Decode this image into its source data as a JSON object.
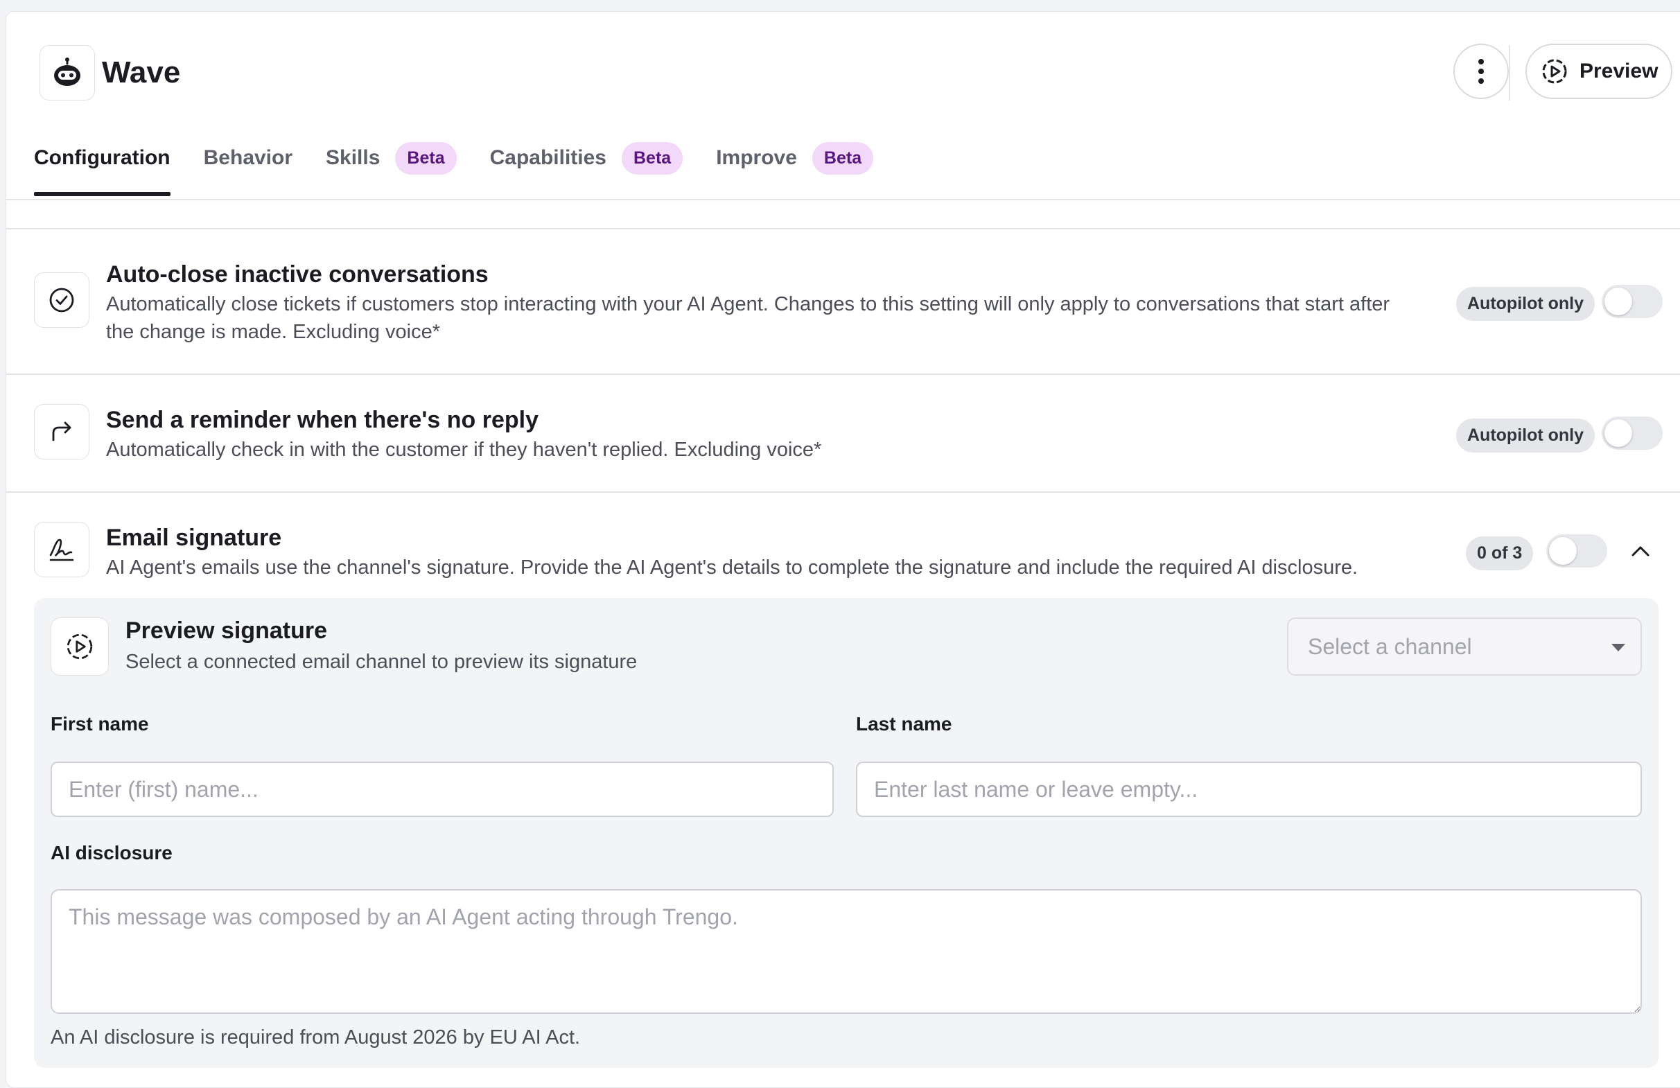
{
  "header": {
    "title": "Wave",
    "logo_icon": "robot-icon",
    "more_icon": "more-vertical-icon",
    "preview_label": "Preview",
    "preview_icon": "play-circle-dashed-icon"
  },
  "tabs": [
    {
      "label": "Configuration",
      "active": true,
      "badge": ""
    },
    {
      "label": "Behavior",
      "active": false,
      "badge": ""
    },
    {
      "label": "Skills",
      "active": false,
      "badge": "Beta"
    },
    {
      "label": "Capabilities",
      "active": false,
      "badge": "Beta"
    },
    {
      "label": "Improve",
      "active": false,
      "badge": "Beta"
    }
  ],
  "settings": {
    "auto_close": {
      "icon": "check-circle-icon",
      "title": "Auto-close inactive conversations",
      "description": "Automatically close tickets if customers stop interacting with your AI Agent. Changes to this setting will only apply to conversations that start after the change is made. Excluding voice*",
      "pill": "Autopilot only",
      "enabled": false
    },
    "reminder": {
      "icon": "forward-arrow-icon",
      "title": "Send a reminder when there's no reply",
      "description": "Automatically check in with the customer if they haven't replied. Excluding voice*",
      "pill": "Autopilot only",
      "enabled": false
    },
    "email_signature": {
      "icon": "signature-icon",
      "title": "Email signature",
      "description": "AI Agent's emails use the channel's signature. Provide the AI Agent's details to complete the signature and include the required AI disclosure.",
      "count": "0 of 3",
      "enabled": false,
      "expanded": true
    }
  },
  "signature": {
    "preview_title": "Preview signature",
    "preview_desc": "Select a connected email channel to preview its signature",
    "channel_placeholder": "Select a channel",
    "first_name_label": "First name",
    "first_name_placeholder": "Enter (first) name...",
    "first_name_value": "",
    "last_name_label": "Last name",
    "last_name_placeholder": "Enter last name or leave empty...",
    "last_name_value": "",
    "disclosure_label": "AI disclosure",
    "disclosure_placeholder": "This message was composed by an AI Agent acting through Trengo.",
    "disclosure_hint": "An AI disclosure is required from August 2026 by EU AI Act."
  },
  "colors": {
    "tab_badge_bg": "#f2d9fa",
    "tab_badge_text": "#5a1680",
    "toggle_off": "#e8e9ed",
    "panel_bg": "#f3f4f6"
  }
}
